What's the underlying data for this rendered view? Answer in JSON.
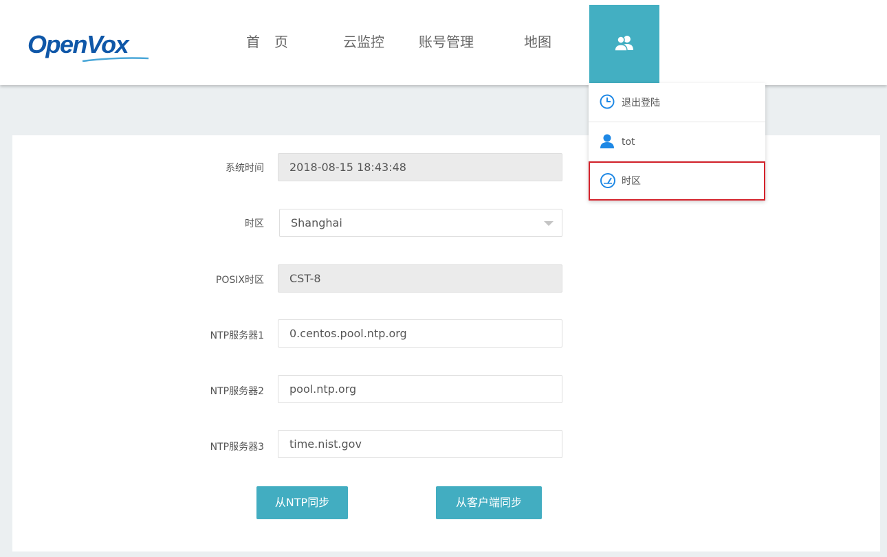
{
  "header": {
    "logo_text": "OpenVox",
    "nav": {
      "home": "首页",
      "cloud_monitor": "云监控",
      "account_management": "账号管理",
      "map": "地图"
    },
    "user_menu_icon": "users-icon"
  },
  "user_dropdown": {
    "items": [
      {
        "label": "退出登陆",
        "icon": "clock-icon"
      },
      {
        "label": "tot",
        "icon": "user-icon"
      },
      {
        "label": "时区",
        "icon": "gauge-icon"
      }
    ]
  },
  "form": {
    "system_time": {
      "label": "系统时间",
      "value": "2018-08-15 18:43:48"
    },
    "timezone": {
      "label": "时区",
      "value": "Shanghai"
    },
    "posix_timezone": {
      "label": "POSIX时区",
      "value": "CST-8"
    },
    "ntp_server_1": {
      "label": "NTP服务器1",
      "value": "0.centos.pool.ntp.org"
    },
    "ntp_server_2": {
      "label": "NTP服务器2",
      "value": "pool.ntp.org"
    },
    "ntp_server_3": {
      "label": "NTP服务器3",
      "value": "time.nist.gov"
    }
  },
  "buttons": {
    "sync_ntp": "从NTP同步",
    "sync_client": "从客户端同步"
  },
  "colors": {
    "accent": "#43afc2",
    "logo": "#0f57a8",
    "highlight_border": "#d4222b",
    "icon_blue": "#1e88e5"
  }
}
